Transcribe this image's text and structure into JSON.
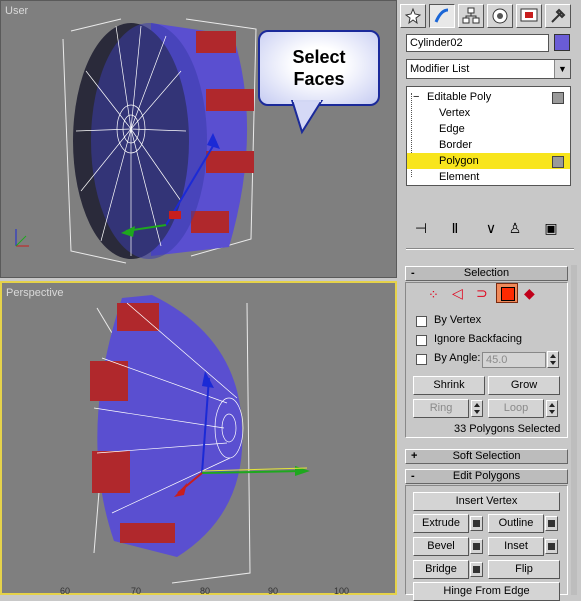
{
  "viewports": {
    "top": {
      "label": "User"
    },
    "bottom": {
      "label": "Perspective"
    }
  },
  "callout": {
    "line1": "Select",
    "line2": "Faces"
  },
  "ruler": {
    "ticks": [
      "60",
      "70",
      "80",
      "90",
      "100"
    ]
  },
  "panel": {
    "tabs": [
      "create-icon",
      "modify-icon",
      "hierarchy-icon",
      "motion-icon",
      "display-icon",
      "utilities-icon"
    ],
    "object_name": "Cylinder02",
    "object_color": "#6a5cd6",
    "modifier_list": "Modifier List",
    "stack": {
      "root": "Editable Poly",
      "items": [
        "Vertex",
        "Edge",
        "Border",
        "Polygon",
        "Element"
      ],
      "selected": "Polygon"
    },
    "selection": {
      "title": "Selection",
      "by_vertex": "By Vertex",
      "ignore_backfacing": "Ignore Backfacing",
      "by_angle": "By Angle:",
      "angle_value": "45.0",
      "shrink": "Shrink",
      "grow": "Grow",
      "ring": "Ring",
      "loop": "Loop",
      "status": "33 Polygons Selected"
    },
    "soft_selection": {
      "title": "Soft Selection"
    },
    "edit_polygons": {
      "title": "Edit Polygons",
      "insert_vertex": "Insert Vertex",
      "extrude": "Extrude",
      "outline": "Outline",
      "bevel": "Bevel",
      "inset": "Inset",
      "bridge": "Bridge",
      "flip": "Flip",
      "hinge_from_edge": "Hinge From Edge"
    },
    "colors": {
      "accent_select": "#f8e51c",
      "poly_active": "#ff2a00"
    }
  }
}
